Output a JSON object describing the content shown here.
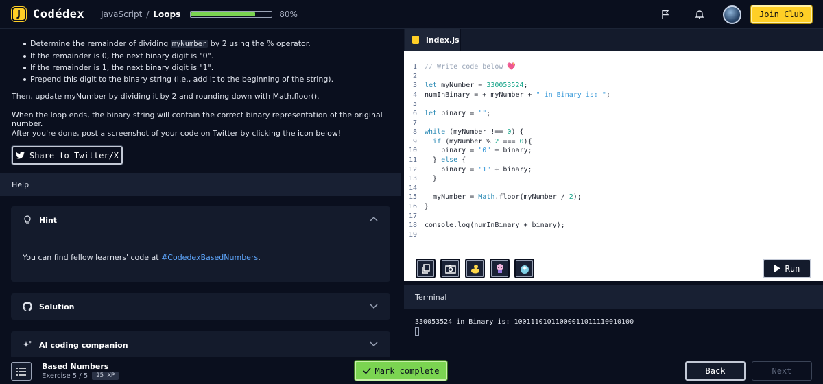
{
  "app": {
    "name": "Codédex",
    "logo_letter": "J"
  },
  "breadcrumb": {
    "course": "JavaScript",
    "separator": "/",
    "chapter": "Loops"
  },
  "progress": {
    "percent": 80,
    "label": "80%"
  },
  "header": {
    "join_label": "Join Club",
    "icons": [
      "flag-icon",
      "bell-icon"
    ]
  },
  "lesson": {
    "bullets": [
      {
        "pre": "Determine the remainder of dividing ",
        "code": "myNumber",
        "post": " by 2 using the % operator."
      },
      {
        "pre": "If the remainder is 0, the next binary digit is \"0\".",
        "code": "",
        "post": ""
      },
      {
        "pre": "If the remainder is 1, the next binary digit is \"1\".",
        "code": "",
        "post": ""
      },
      {
        "pre": "Prepend this digit to the binary string (i.e., add it to the beginning of the string).",
        "code": "",
        "post": ""
      }
    ],
    "para1": "Then, update myNumber by dividing it by 2 and rounding down with Math.floor().",
    "para2": "When the loop ends, the binary string will contain the correct binary representation of the original number.",
    "para3": "After you're done, post a screenshot of your code on Twitter by clicking the icon below!",
    "share_label": "Share to Twitter/X"
  },
  "help": {
    "title": "Help",
    "hint": {
      "title": "Hint",
      "body_pre": "You can find fellow learners' code at ",
      "body_link": "#CodedexBasedNumbers",
      "body_post": "."
    },
    "solution": {
      "title": "Solution"
    },
    "companion": {
      "title": "AI coding companion"
    }
  },
  "editor": {
    "filename": "index.js",
    "lines": [
      "<span class=\"cmt\">// Write code below 💖</span>",
      "",
      "<span class=\"kw\">let</span> myNumber = <span class=\"num\">330053524</span>;",
      "numInBinary = + myNumber + <span class=\"str\">\" in Binary is: \"</span>;",
      "",
      "<span class=\"kw\">let</span> binary = <span class=\"str\">\"\"</span>;",
      "",
      "<span class=\"kw\">while</span> (myNumber !== <span class=\"num\">0</span>) {",
      "  <span class=\"kw\">if</span> (myNumber % <span class=\"num\">2</span> === <span class=\"num\">0</span>){",
      "    binary = <span class=\"str\">\"0\"</span> + binary;",
      "  } <span class=\"kw\">else</span> {",
      "    binary = <span class=\"str\">\"1\"</span> + binary;",
      "  }",
      "",
      "  myNumber = <span class=\"kw\">Math</span>.floor(myNumber / <span class=\"num\">2</span>);",
      "}",
      "",
      "console.log(numInBinary + binary);",
      ""
    ],
    "run_label": "Run",
    "tool_icons": [
      "copy-icon",
      "camera-icon",
      "duck-icon",
      "bubble-icon",
      "sparkle-icon"
    ]
  },
  "terminal": {
    "title": "Terminal",
    "output": "330053524 in Binary is: 10011101011000011011110010100"
  },
  "footer": {
    "exercise_title": "Based Numbers",
    "exercise_sub": "Exercise 5 / 5",
    "xp": "25 XP",
    "mark_label": "Mark complete",
    "back_label": "Back",
    "next_label": "Next"
  }
}
